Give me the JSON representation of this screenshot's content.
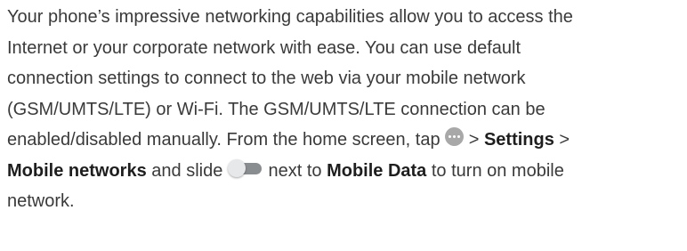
{
  "paragraph": {
    "line1": "Your phone’s impressive networking capabilities allow you to access the",
    "line2": "Internet or your corporate network with ease. You can use default",
    "line3": "connection settings to connect to the web via your mobile network",
    "line4": "(GSM/UMTS/LTE) or Wi-Fi. The GSM/UMTS/LTE connection can be",
    "line5_pre": "enabled/disabled manually. From the home screen, tap",
    "line5_sep": ">",
    "settings": "Settings",
    "line5_post": ">",
    "mobile_networks": "Mobile networks",
    "line6_mid1": "and slide",
    "line6_mid2": "next to",
    "mobile_data": "Mobile Data",
    "line6_post": "to turn on mobile",
    "line7": "network."
  },
  "icons": {
    "apps": "apps-icon",
    "toggle": "toggle-switch-icon"
  },
  "colors": {
    "text": "#3a3a3a",
    "icon_gray": "#a8a8a8",
    "toggle_track": "#8a8d90"
  }
}
